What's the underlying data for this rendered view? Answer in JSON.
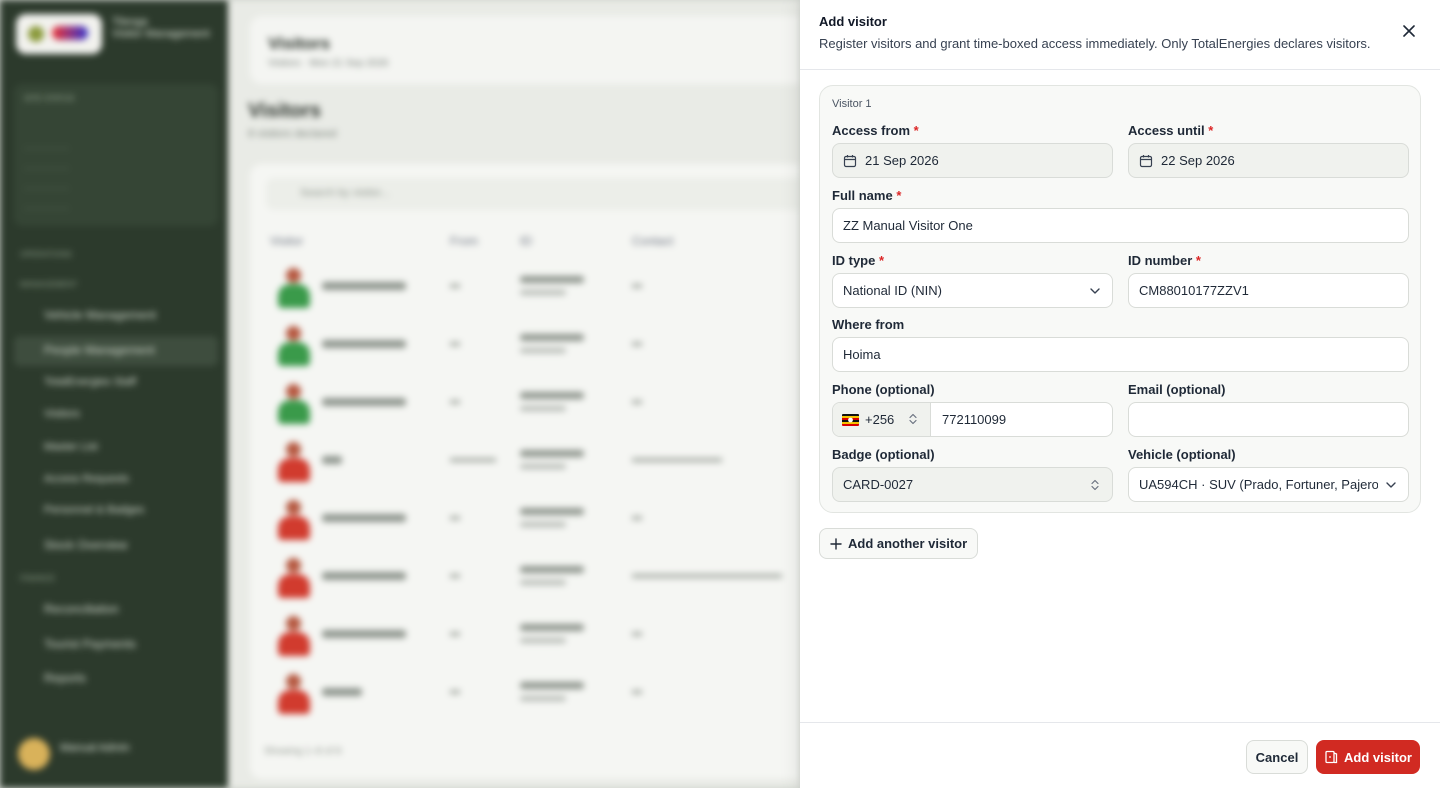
{
  "background": {
    "brand_title": "Tilenga",
    "brand_subtitle": "Visitor Management",
    "header_title": "Visitors",
    "header_subtitle": "Visitors · Mon 21 Sep 2026",
    "page_title": "Visitors",
    "page_subtitle": "8 visitors declared",
    "search_placeholder": "Search by visitor...",
    "columns": [
      "Visitor",
      "From",
      "ID",
      "Contact"
    ],
    "nav": [
      "Vehicle Management",
      "People Management",
      "TotalEnergies Staff",
      "Visitors",
      "Master List",
      "Access Requests",
      "Personnel & Badges",
      "Stock Overview",
      "Reconciliation",
      "Tourist Payments",
      "Reports"
    ],
    "user_name": "Manual Admin",
    "footer_text": "Showing 1–8 of 8"
  },
  "drawer": {
    "title": "Add visitor",
    "description": "Register visitors and grant time-boxed access immediately. Only TotalEnergies declares visitors.",
    "visitor_label": "Visitor 1",
    "access_from": {
      "label": "Access from",
      "required": "*",
      "value": "21 Sep 2026"
    },
    "access_until": {
      "label": "Access until",
      "required": "*",
      "value": "22 Sep 2026"
    },
    "full_name": {
      "label": "Full name",
      "required": "*",
      "value": "ZZ Manual Visitor One"
    },
    "id_type": {
      "label": "ID type",
      "required": "*",
      "value": "National ID (NIN)"
    },
    "id_number": {
      "label": "ID number",
      "required": "*",
      "value": "CM88010177ZZV1"
    },
    "where_from": {
      "label": "Where from",
      "value": "Hoima"
    },
    "phone": {
      "label": "Phone (optional)",
      "country_code": "+256",
      "value": "772110099"
    },
    "email": {
      "label": "Email (optional)",
      "value": ""
    },
    "badge": {
      "label": "Badge (optional)",
      "value": "CARD-0027"
    },
    "vehicle": {
      "label": "Vehicle (optional)",
      "value": "UA594CH · SUV (Prado, Fortuner, Pajero,"
    },
    "add_another_label": "Add another visitor",
    "cancel_label": "Cancel",
    "submit_label": "Add visitor"
  },
  "colors": {
    "accent": "#d12a22",
    "required": "#dc2626",
    "sidebar": "#2c3a2c"
  }
}
